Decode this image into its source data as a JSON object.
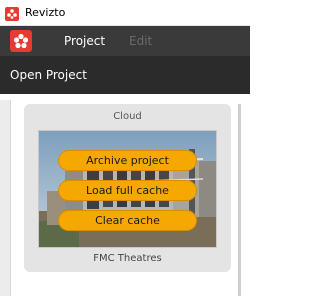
{
  "window": {
    "title": "Revizto"
  },
  "menubar": {
    "logo": "revizto-logo-icon",
    "items": [
      {
        "label": "Project",
        "enabled": true
      },
      {
        "label": "Edit",
        "enabled": false
      }
    ]
  },
  "open_project": {
    "label": "Open Project"
  },
  "card": {
    "header": "Cloud",
    "project_name": "FMC Theatres",
    "thumbnail": "project-thumbnail",
    "actions": [
      {
        "label": "Archive project"
      },
      {
        "label": "Load full cache"
      },
      {
        "label": "Clear cache"
      }
    ]
  },
  "colors": {
    "brand_red": "#e63b2e",
    "menubar_bg": "#3a3a3a",
    "open_bar_bg": "#2b2b2b",
    "button_orange": "#f5a800"
  }
}
